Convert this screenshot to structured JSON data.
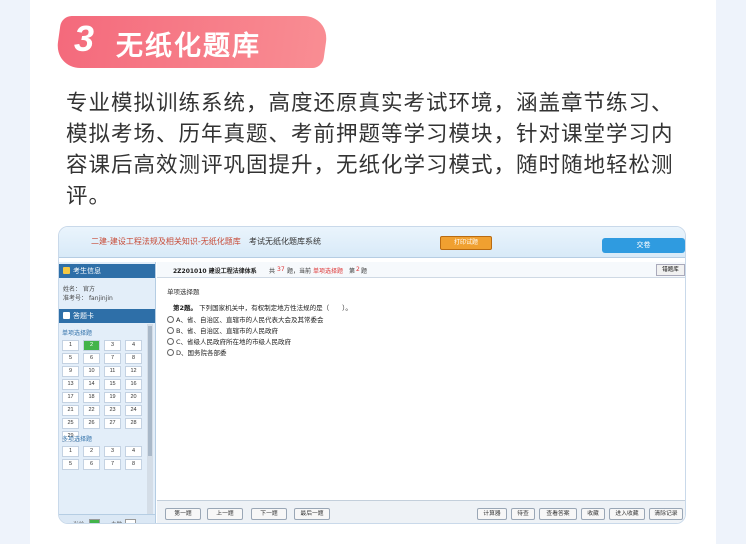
{
  "feature": {
    "number": "3",
    "title": "无纸化题库",
    "description": "专业模拟训练系统，高度还原真实考试环境，涵盖章节练习、模拟考场、历年真题、考前押题等学习模块，针对课堂学习内容课后高效测评巩固提升，无纸化学习模式，随时随地轻松测评。"
  },
  "colors": {
    "badge": "#f46a7c",
    "header_blue": "#2e6fa8",
    "submit_blue": "#2f9be0",
    "print_orange": "#f0a030",
    "current_green": "#43b44a"
  },
  "app": {
    "title": "二建-建设工程法规及相关知识-无纸化题库",
    "system": "考试无纸化题库系统",
    "print_label": "打印试题",
    "submit_label": "交卷"
  },
  "sidebar": {
    "candidate_header": "考生信息",
    "name_label": "姓名：",
    "name": "官方",
    "id_label": "准考号：",
    "id": "fanjinjin",
    "answer_card_header": "答题卡",
    "single_title": "单项选择题",
    "single_numbers": [
      "1",
      "2",
      "3",
      "4",
      "5",
      "6",
      "7",
      "8",
      "9",
      "10",
      "11",
      "12",
      "13",
      "14",
      "15",
      "16",
      "17",
      "18",
      "19",
      "20",
      "21",
      "22",
      "23",
      "24",
      "25",
      "26",
      "27",
      "28",
      "29"
    ],
    "multi_title": "多项选择题",
    "multi_numbers": [
      "1",
      "2",
      "3",
      "4",
      "5",
      "6",
      "7",
      "8"
    ],
    "legend": {
      "current": "当前",
      "unanswered": "未做",
      "review": "待查",
      "answered": "已做"
    }
  },
  "question": {
    "code": "2Z201010 建设工程法律体系",
    "total_prefix": "共",
    "total": "37",
    "total_suffix": "题，当前",
    "current_type": "单项选择题",
    "index_prefix": "第",
    "index": "2",
    "index_suffix": "题",
    "favorite": "错题库",
    "section": "单项选择题",
    "number": "第2题。",
    "stem": "下列国家机关中，有权制定地方性法规的是（　　）。",
    "options": [
      "A、省、自治区、直辖市的人民代表大会及其常委会",
      "B、省、自治区、直辖市的人民政府",
      "C、省级人民政府所在地的市级人民政府",
      "D、国务院各部委"
    ]
  },
  "footer": {
    "nav": [
      "第一题",
      "上一题",
      "下一题",
      "最后一题"
    ],
    "tools": [
      "计算器",
      "待查",
      "查看答案",
      "收藏",
      "进入收藏",
      "清除记录"
    ]
  }
}
